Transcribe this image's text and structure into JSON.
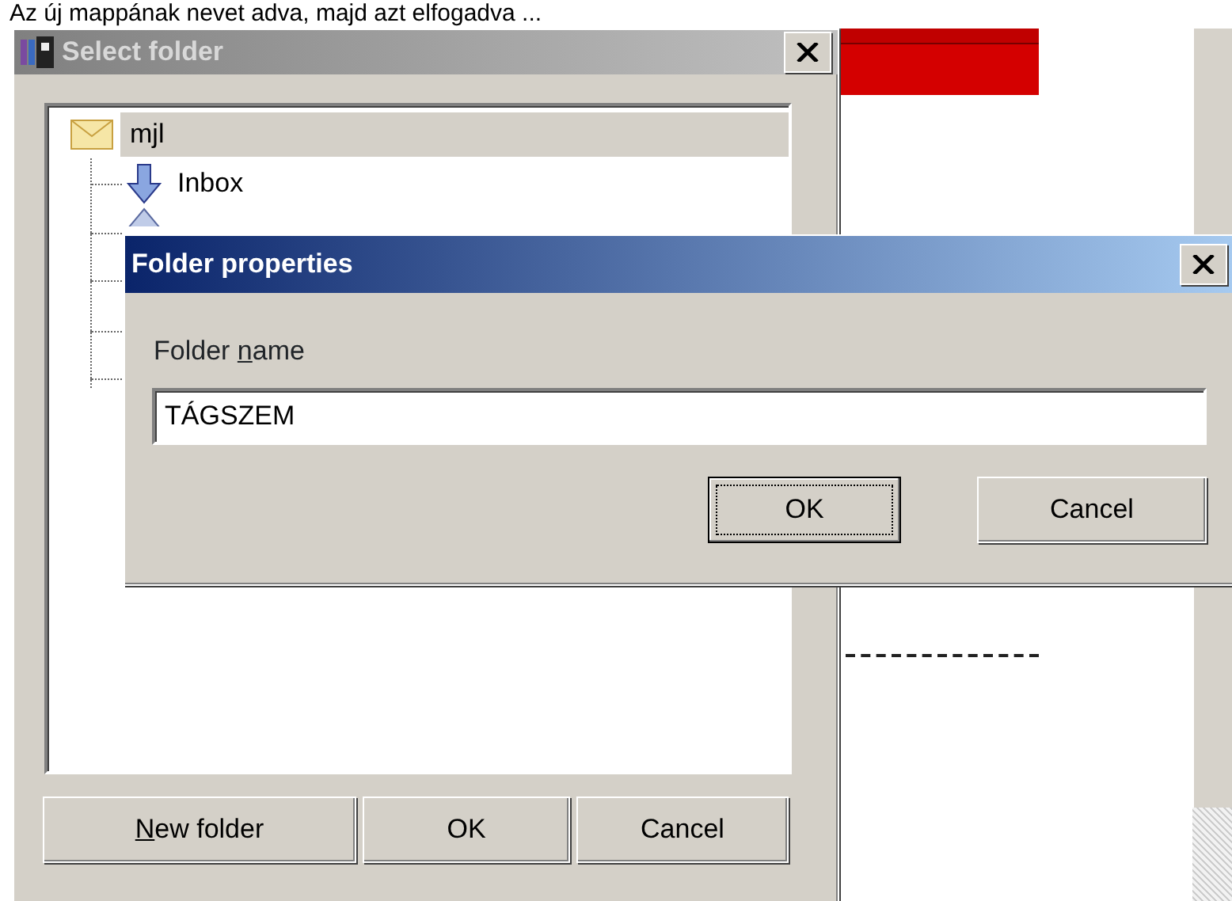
{
  "caption": "Az új mappának nevet adva, majd azt elfogadva ...",
  "select_folder": {
    "title": "Select folder",
    "active": false,
    "tree": [
      {
        "label": "mjl",
        "kind": "account",
        "selected": true,
        "children": [
          {
            "label": "Inbox",
            "kind": "inbox",
            "selected": false
          },
          {
            "kind": "outbox",
            "selected": false
          }
        ]
      }
    ],
    "buttons": [
      {
        "label": "New folder",
        "mnemonic": true,
        "mnemonic_last_word": false,
        "default": false
      },
      {
        "label": "OK",
        "default": false
      },
      {
        "label": "Cancel",
        "default": false
      }
    ]
  },
  "folder_properties": {
    "title": "Folder properties",
    "active": true,
    "field_label": "Folder name",
    "field_mnemonic": true,
    "field_mnemonic_last_word": true,
    "value": "TÁGSZEM",
    "buttons": [
      {
        "label": "OK",
        "default": true
      },
      {
        "label": "Cancel",
        "default": false
      }
    ]
  }
}
